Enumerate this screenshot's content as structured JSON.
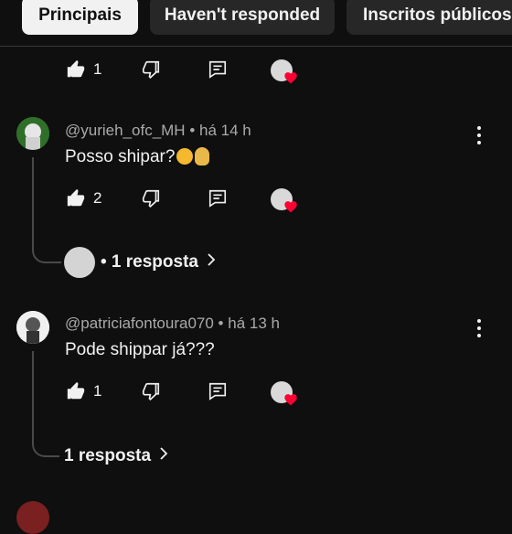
{
  "tabs": [
    {
      "label": "Principais",
      "active": true
    },
    {
      "label": "Haven't responded",
      "active": false
    },
    {
      "label": "Inscritos públicos",
      "active": false
    }
  ],
  "colors": {
    "background": "#0f0f0f",
    "heart": "#ff0033",
    "text": "#f1f1f1",
    "meta": "#aaaaaa"
  },
  "top_comment_actions": {
    "like_count": "1"
  },
  "comments": [
    {
      "author": "@yurieh_ofc_MH",
      "time": "há 14 h",
      "text": "Posso shipar?",
      "like_count": "2",
      "replies_label": "• 1 resposta"
    },
    {
      "author": "@patriciafontoura070",
      "time": "há 13 h",
      "text": "Pode shippar já???",
      "like_count": "1",
      "replies_label": "1 resposta"
    }
  ],
  "icons": {
    "like": "thumb-up-icon",
    "dislike": "thumb-down-icon",
    "reply": "comment-reply-icon",
    "heart": "creator-heart-icon",
    "more": "more-vert-icon",
    "chevron": "chevron-right-icon"
  }
}
